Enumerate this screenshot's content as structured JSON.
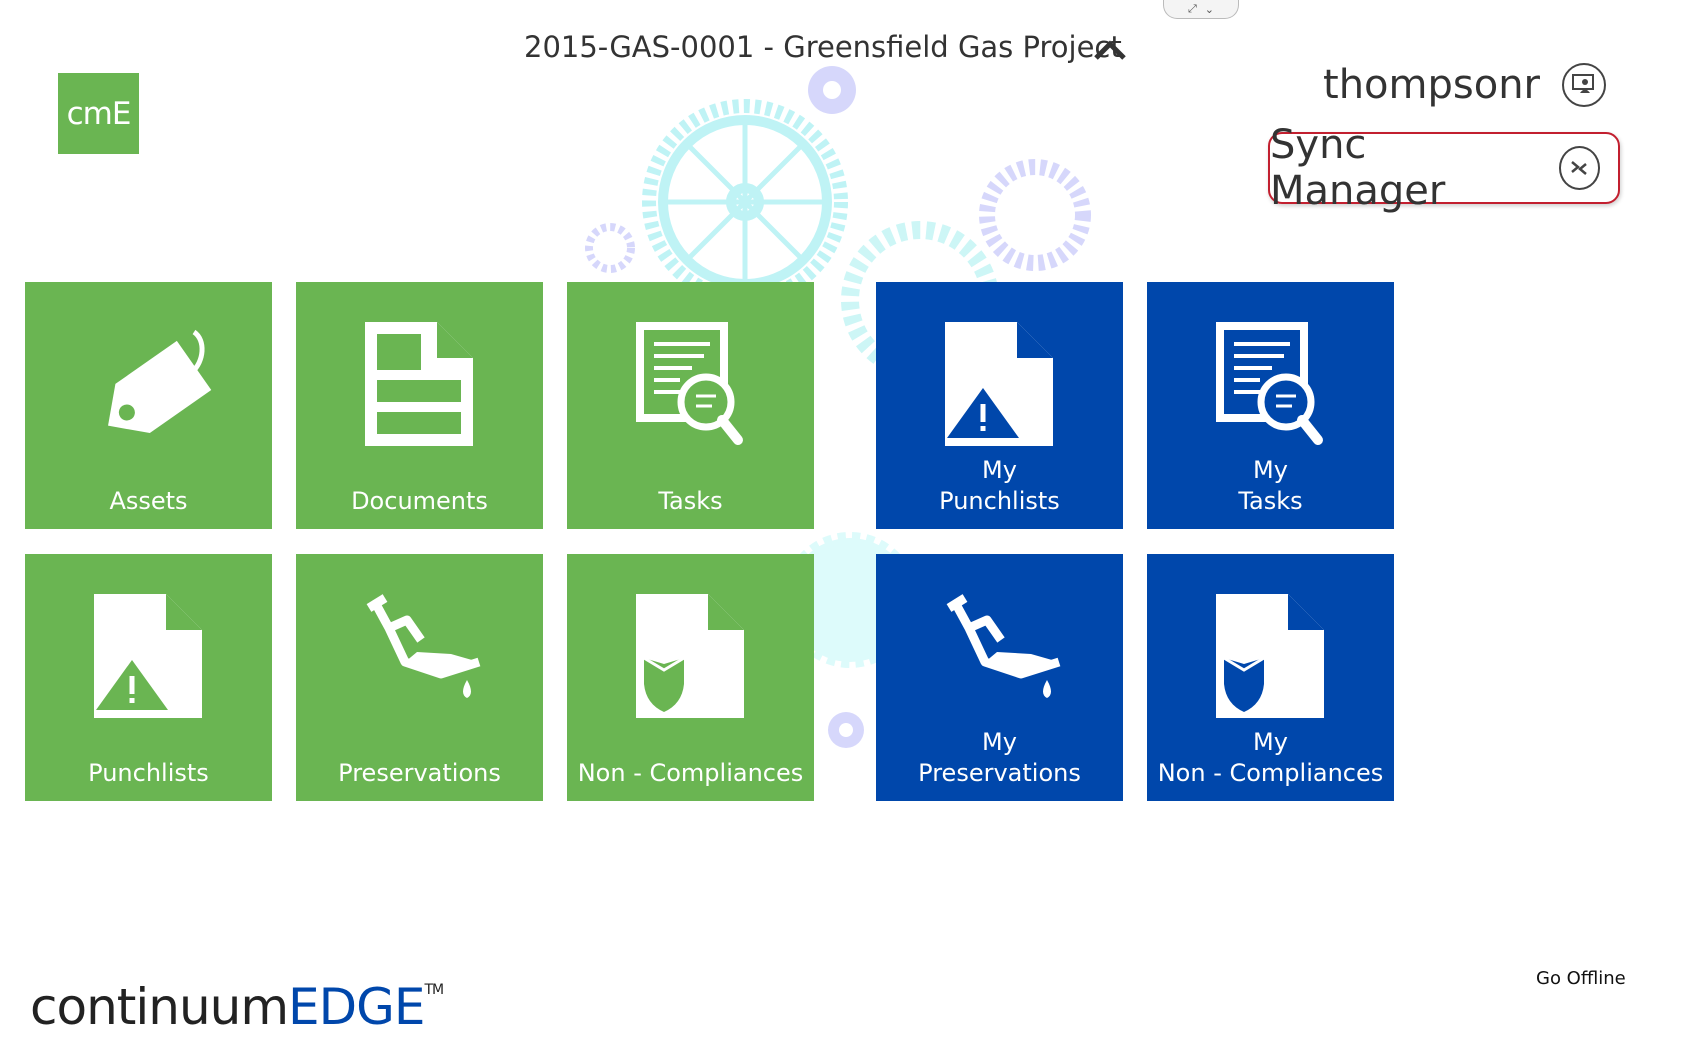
{
  "header": {
    "project_title": "2015-GAS-0001 - Greensfield Gas Project",
    "logo_text": "cmE",
    "username": "thompsonr",
    "sync_label": "Sync Manager"
  },
  "tiles": [
    {
      "label": "Assets"
    },
    {
      "label": "Documents"
    },
    {
      "label": "Tasks"
    },
    {
      "label_line1": "My",
      "label_line2": "Punchlists"
    },
    {
      "label_line1": "My",
      "label_line2": "Tasks"
    },
    {
      "label": "Punchlists"
    },
    {
      "label": "Preservations"
    },
    {
      "label": "Non - Compliances"
    },
    {
      "label_line1": "My",
      "label_line2": "Preservations"
    },
    {
      "label_line1": "My",
      "label_line2": "Non - Compliances"
    }
  ],
  "footer": {
    "brand_part1": "continuum",
    "brand_part2": "EDGE",
    "brand_tm": "TM",
    "go_offline": "Go Offline"
  },
  "colors": {
    "green_tile": "#6ab552",
    "blue_tile": "#0047ab",
    "highlight_border": "#c21f2f"
  }
}
